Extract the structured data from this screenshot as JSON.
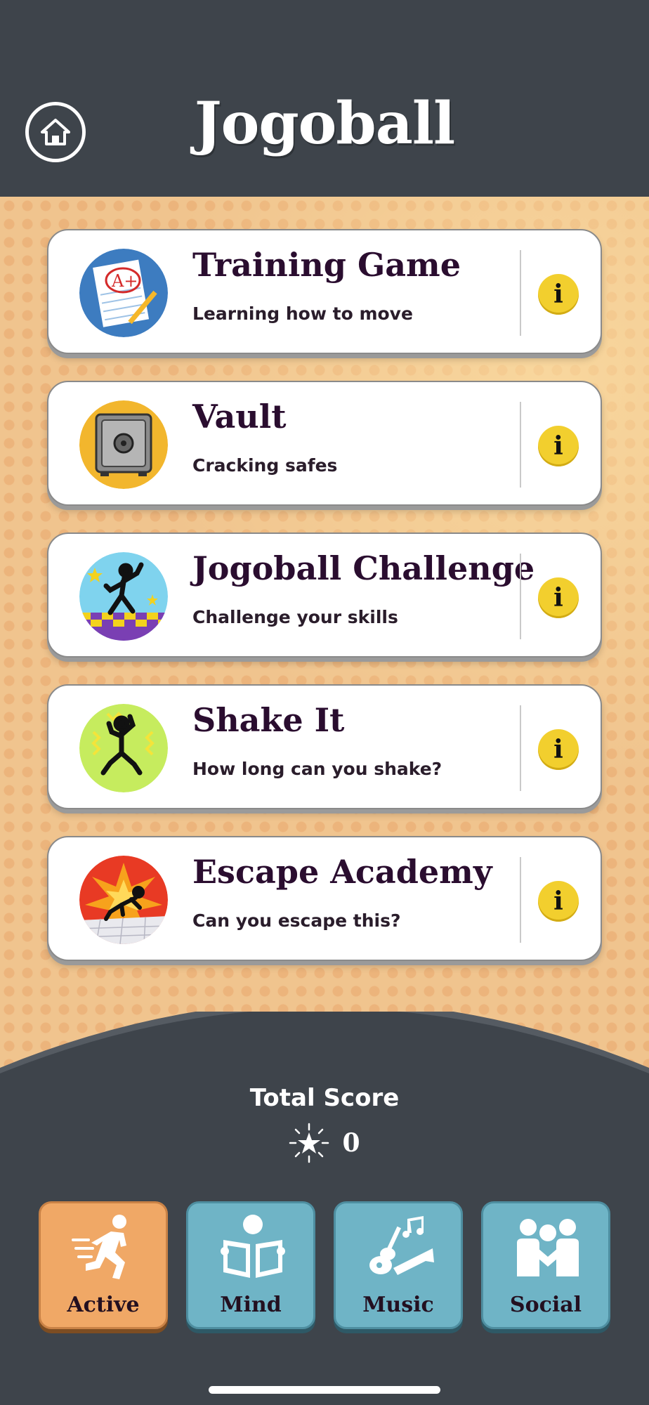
{
  "header": {
    "app_title": "Jogoball",
    "home_icon": "home-icon"
  },
  "games": [
    {
      "title": "Training Game",
      "subtitle": "Learning how to move",
      "icon": "grade-paper-icon",
      "info": "i"
    },
    {
      "title": "Vault",
      "subtitle": "Cracking safes",
      "icon": "safe-icon",
      "info": "i"
    },
    {
      "title": "Jogoball Challenge",
      "subtitle": "Challenge your skills",
      "icon": "dancer-icon",
      "info": "i"
    },
    {
      "title": "Shake It",
      "subtitle": "How long can you shake?",
      "icon": "shaking-figure-icon",
      "info": "i"
    },
    {
      "title": "Escape Academy",
      "subtitle": "Can you escape this?",
      "icon": "escaping-figure-icon",
      "info": "i"
    }
  ],
  "score": {
    "label": "Total Score",
    "value": "0",
    "icon": "star-burst-icon"
  },
  "tabs": [
    {
      "label": "Active",
      "icon": "running-person-icon",
      "selected": true
    },
    {
      "label": "Mind",
      "icon": "reading-person-icon",
      "selected": false
    },
    {
      "label": "Music",
      "icon": "instruments-icon",
      "selected": false
    },
    {
      "label": "Social",
      "icon": "group-people-icon",
      "selected": false
    }
  ],
  "colors": {
    "header_bg": "#3e444b",
    "content_bg": "#f0c48e",
    "info_button": "#f2cf2e",
    "tab_active": "#f0a866",
    "tab_inactive": "#6fb4c6",
    "title_text": "#2a0d2f"
  }
}
